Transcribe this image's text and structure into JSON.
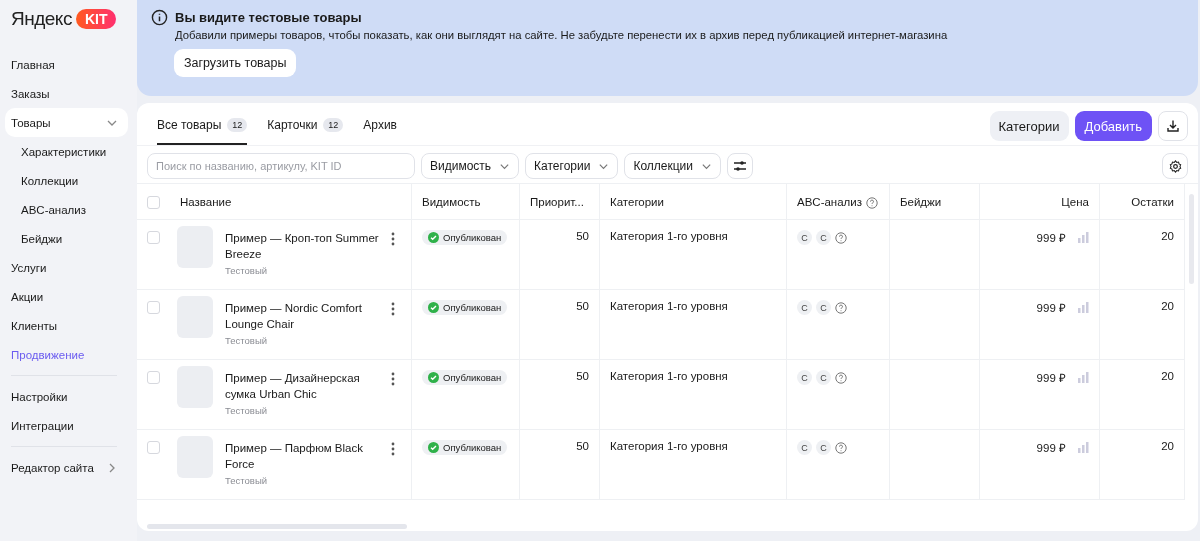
{
  "logo": {
    "text": "Яндекс",
    "badge": "KIT"
  },
  "sidebar": {
    "groups": [
      [
        {
          "label": "Главная",
          "selected": false
        },
        {
          "label": "Заказы",
          "selected": false
        },
        {
          "label": "Товары",
          "selected": true,
          "expanded": true,
          "children": [
            {
              "label": "Характеристики"
            },
            {
              "label": "Коллекции"
            },
            {
              "label": "ABC-анализ"
            },
            {
              "label": "Бейджи"
            }
          ]
        },
        {
          "label": "Услуги",
          "selected": false
        },
        {
          "label": "Акции",
          "selected": false
        },
        {
          "label": "Клиенты",
          "selected": false
        },
        {
          "label": "Продвижение",
          "selected": false,
          "highlighted": true
        }
      ],
      [
        {
          "label": "Настройки",
          "selected": false
        },
        {
          "label": "Интеграции",
          "selected": false
        }
      ],
      [
        {
          "label": "Редактор сайта",
          "selected": false,
          "kind": "link"
        }
      ]
    ]
  },
  "banner": {
    "title": "Вы видите тестовые товары",
    "text": "Добавили примеры товаров, чтобы показать, как они выглядят на сайте. Не забудьте перенести их в архив перед публикацией интернет-магазина",
    "button": "Загрузить товары"
  },
  "tabs": [
    {
      "label": "Все товары",
      "count": "12",
      "selected": true
    },
    {
      "label": "Карточки",
      "count": "12",
      "selected": false
    },
    {
      "label": "Архив",
      "selected": false
    }
  ],
  "actions": {
    "categories": "Категории",
    "add": "Добавить"
  },
  "filters": {
    "search_placeholder": "Поиск по названию, артикулу, KIT ID",
    "dropdowns": [
      "Видимость",
      "Категории",
      "Коллекции"
    ]
  },
  "table": {
    "all_checked": false,
    "columns": [
      "Название",
      "Видимость",
      "Приорит...",
      "Категории",
      "ABC-анализ",
      "Бейджи",
      "Цена",
      "Остатки"
    ],
    "rows": [
      {
        "name": "Пример — Кроп-топ Summer Breeze",
        "tag": "Тестовый",
        "status": "Опубликован",
        "priority": "50",
        "category": "Категория 1-го уровня",
        "abc": [
          "C",
          "C"
        ],
        "price": "999 ₽",
        "stock": "20",
        "checked": false
      },
      {
        "name": "Пример — Nordic Comfort Lounge Chair",
        "tag": "Тестовый",
        "status": "Опубликован",
        "priority": "50",
        "category": "Категория 1-го уровня",
        "abc": [
          "C",
          "C"
        ],
        "price": "999 ₽",
        "stock": "20",
        "checked": false
      },
      {
        "name": "Пример — Дизайнерская сумка Urban Chic",
        "tag": "Тестовый",
        "status": "Опубликован",
        "priority": "50",
        "category": "Категория 1-го уровня",
        "abc": [
          "C",
          "C"
        ],
        "price": "999 ₽",
        "stock": "20",
        "checked": false
      },
      {
        "name": "Пример — Парфюм Black Force",
        "tag": "Тестовый",
        "status": "Опубликован",
        "priority": "50",
        "category": "Категория 1-го уровня",
        "abc": [
          "C",
          "C"
        ],
        "price": "999 ₽",
        "stock": "20",
        "checked": false
      }
    ]
  }
}
